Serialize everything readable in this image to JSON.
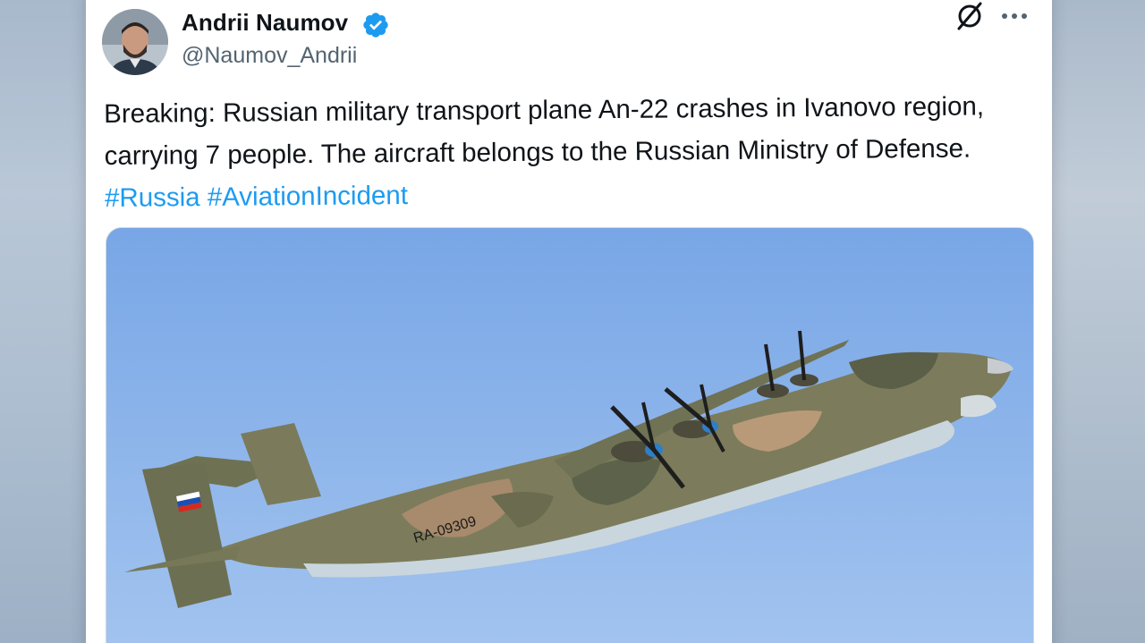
{
  "tweet": {
    "author_name": "Andrii Naumov",
    "author_handle": "@Naumov_Andrii",
    "verified": true,
    "text_plain": "Breaking: Russian military transport plane An-22 crashes in Ivanovo region, carrying 7 people. The aircraft belongs to the Russian Ministry of Defense.",
    "hashtags": [
      "#Russia",
      "#AviationIncident"
    ],
    "hashtag_color": "#1d9bf0"
  },
  "header_icons": [
    "grok-icon",
    "more-options-icon"
  ],
  "media": {
    "aircraft_registration": "RA-09309"
  },
  "colors": {
    "text": "#0f1419",
    "secondary_text": "#536471",
    "badge": "#1d9bf0"
  }
}
